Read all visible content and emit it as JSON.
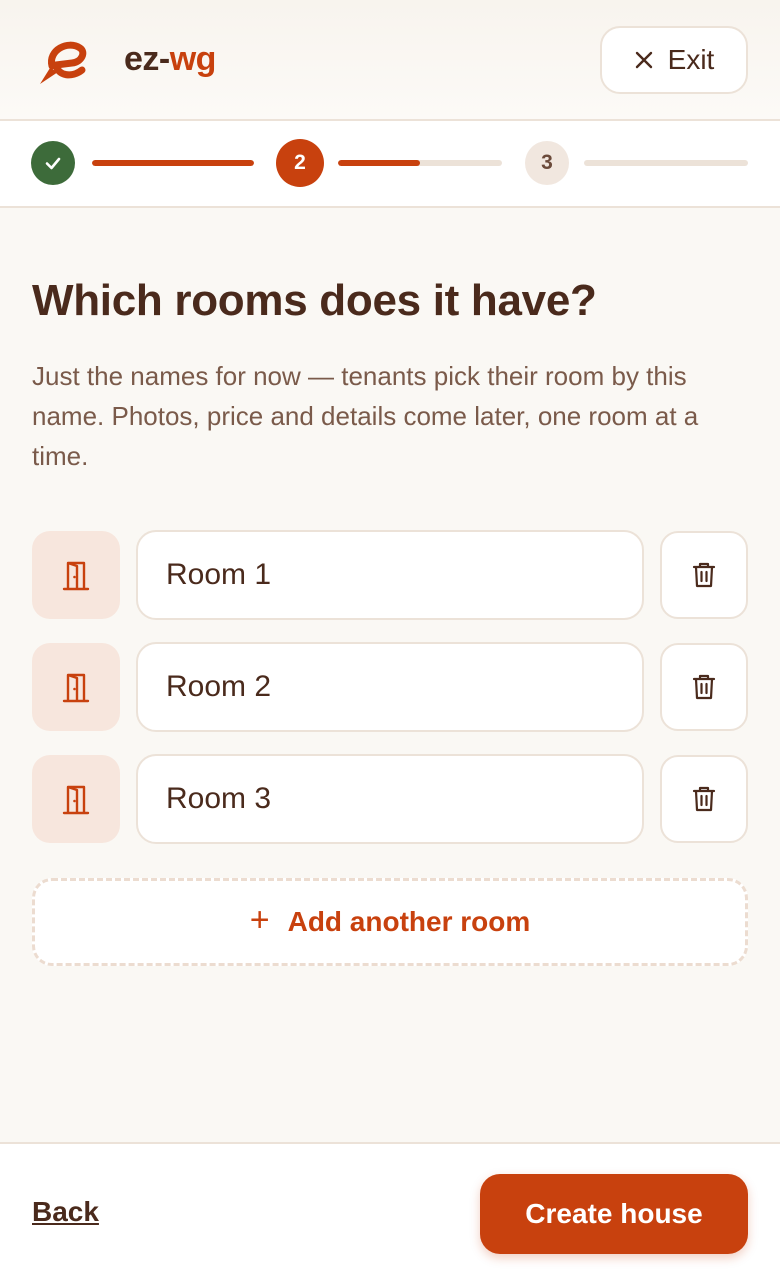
{
  "header": {
    "brand_part1": "ez-",
    "brand_part2": "wg",
    "exit_label": "Exit"
  },
  "stepper": {
    "steps": [
      {
        "label": "",
        "state": "done"
      },
      {
        "label": "2",
        "state": "active"
      },
      {
        "label": "3",
        "state": "todo"
      }
    ],
    "connector_progress": [
      1.0,
      0.5,
      0.0
    ]
  },
  "main": {
    "title": "Which rooms does it have?",
    "subtitle": "Just the names for now — tenants pick their room by this name. Photos, price and details come later, one room at a time.",
    "rooms": [
      {
        "value": "Room 1"
      },
      {
        "value": "Room 2"
      },
      {
        "value": "Room 3"
      }
    ],
    "add_room_label": "Add another room"
  },
  "footer": {
    "back_label": "Back",
    "create_label": "Create house"
  },
  "colors": {
    "accent": "#c8410e",
    "success": "#3d6b3a",
    "text": "#4a2a1c"
  },
  "icons": {
    "logo": "ez-wg-logo-icon",
    "exit": "close-icon",
    "done_step": "check-icon",
    "room": "door-icon",
    "delete": "trash-icon",
    "add": "plus-icon"
  }
}
